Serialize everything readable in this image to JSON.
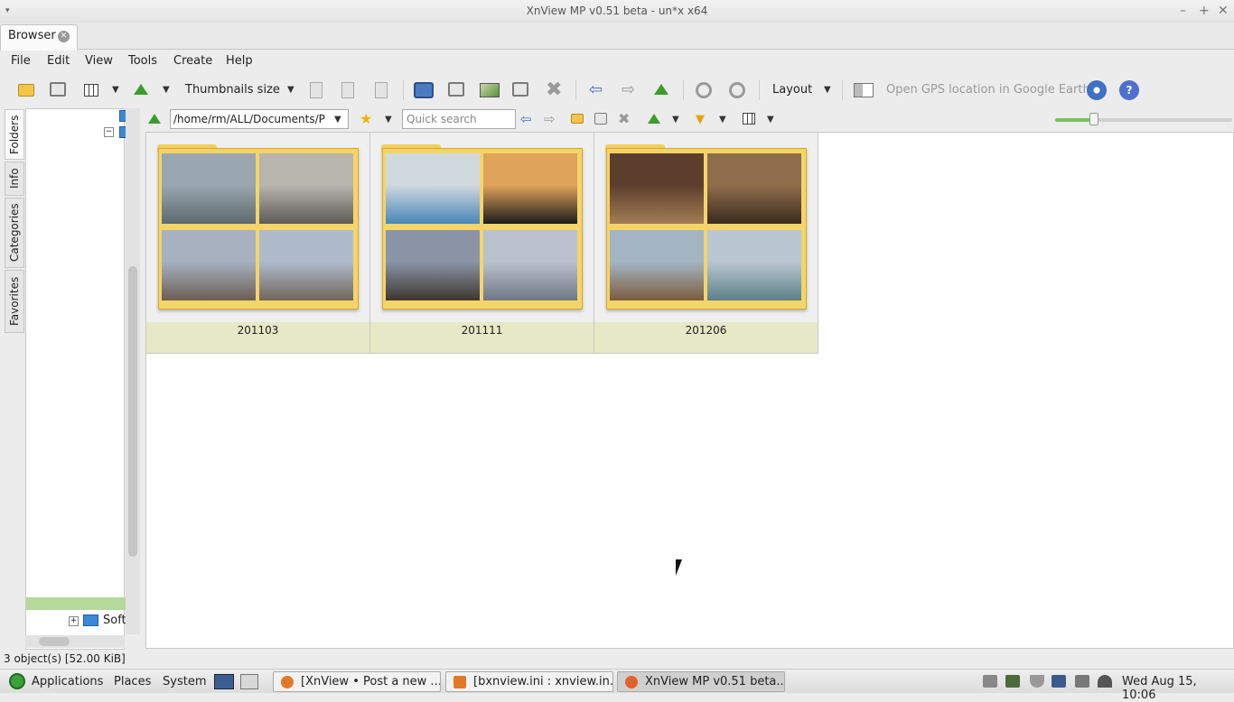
{
  "window": {
    "title": "XnView MP v0.51 beta - un*x x64",
    "menu_glyph": "▾",
    "min": "–",
    "max": "+",
    "close": "✕"
  },
  "tabs": [
    {
      "label": "Browser",
      "close": "✕"
    }
  ],
  "menu": [
    "File",
    "Edit",
    "View",
    "Tools",
    "Create",
    "Help"
  ],
  "toolbar": {
    "thumbnails_label": "Thumbnails size",
    "layout_label": "Layout",
    "gps_label": "Open GPS location in Google Earth",
    "dropdown": "▼",
    "help": "?",
    "left_arrow": "⇦",
    "right_arrow": "⇨",
    "delete": "✖"
  },
  "sidebar_tabs": [
    "Folders",
    "Info",
    "Categories",
    "Favorites"
  ],
  "folder_tree": {
    "expand": "+",
    "items": [
      "Soft"
    ]
  },
  "address": {
    "path": "/home/rm/ALL/Documents/P",
    "search_placeholder": "Quick search",
    "star": "★",
    "dropdown": "▼",
    "funnel": "▼"
  },
  "zoom": {
    "value_fraction": 0.22
  },
  "browser": {
    "folders": [
      {
        "name": "201103",
        "photo_colors": [
          [
            "#9aa7b0",
            "#5d6a6f"
          ],
          [
            "#b8b4ae",
            "#5e5a56"
          ],
          [
            "#a7b1c0",
            "#6c5e54"
          ],
          [
            "#aebbcc",
            "#71655a"
          ]
        ]
      },
      {
        "name": "201111",
        "photo_colors": [
          [
            "#cfd9de",
            "#4a86b8"
          ],
          [
            "#e0a35a",
            "#1c1c1c"
          ],
          [
            "#8a94a6",
            "#3d3630"
          ],
          [
            "#b9c2cc",
            "#6f7886"
          ]
        ]
      },
      {
        "name": "201206",
        "photo_colors": [
          [
            "#5b3f2c",
            "#a37c54"
          ],
          [
            "#8e6d4b",
            "#3b2b1f"
          ],
          [
            "#a3b5c3",
            "#7b5d3f"
          ],
          [
            "#b8c7d2",
            "#5e7f86"
          ]
        ]
      }
    ]
  },
  "status": {
    "text": "3 object(s) [52.00 KiB]"
  },
  "taskbar": {
    "applications": "Applications",
    "places": "Places",
    "system": "System",
    "tasks": [
      {
        "label": "[XnView • Post a new ..."
      },
      {
        "label": "[bxnview.ini : xnview.in..."
      },
      {
        "label": "XnView MP v0.51 beta..."
      }
    ],
    "clock": "Wed Aug 15, 10:06"
  }
}
